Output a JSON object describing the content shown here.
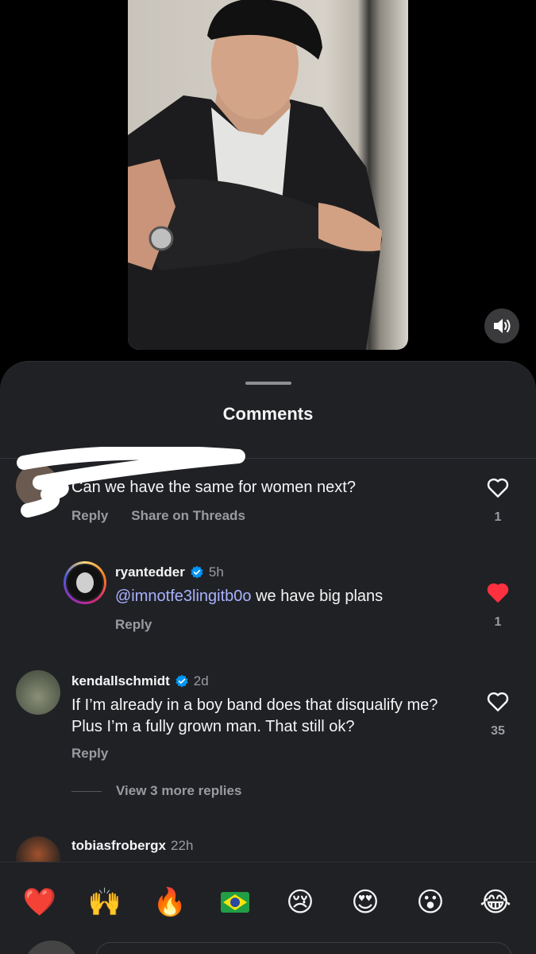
{
  "sheet": {
    "title": "Comments"
  },
  "comments": [
    {
      "username": "",
      "text": "Can we have the same for women next?",
      "reply_label": "Reply",
      "share_label": "Share on Threads",
      "likes": "1",
      "liked": false,
      "avatar_icon": "redacted-avatar"
    },
    {
      "username": "ryantedder",
      "verified": true,
      "time": "5h",
      "mention": "@imnotfe3lingitb0o",
      "text": " we have big plans",
      "reply_label": "Reply",
      "likes": "1",
      "liked": true,
      "accent": "#ff3040"
    },
    {
      "username": "kendallschmidt",
      "verified": true,
      "time": "2d",
      "text": "If I’m already in a boy band does that disqualify me? Plus I’m a fully grown man. That still ok?",
      "reply_label": "Reply",
      "likes": "35",
      "liked": false,
      "view_more": "View 3 more replies"
    },
    {
      "username": "tobiasfrobergx",
      "time": "22h"
    }
  ],
  "emoji_bar": {
    "emojis": [
      "❤️",
      "🙌",
      "🔥",
      "🇧🇷",
      "😢",
      "😍",
      "😮",
      "😂"
    ]
  },
  "colors": {
    "verified": "#0095f6",
    "like_red": "#ff3040",
    "mention": "#a8b2ff",
    "sheet_bg": "#202125"
  },
  "icons": {
    "sound": "speaker-icon",
    "like": "heart-icon",
    "verified": "verified-badge-icon"
  }
}
